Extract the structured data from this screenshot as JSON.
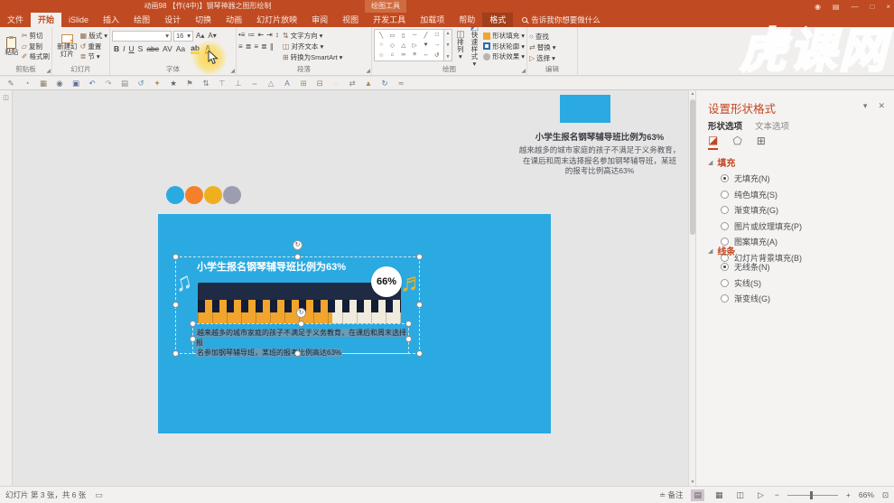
{
  "accent": "#c2471e",
  "watermark": "虎课网",
  "window": {
    "title": "动画98 【作(4中)】钢琴神器之图形绘制",
    "context_tab_header": "绘图工具",
    "controls": [
      {
        "name": "account-icon",
        "glyph": "◉"
      },
      {
        "name": "ribbon-display-options-icon",
        "glyph": "▤"
      },
      {
        "name": "minimize-icon",
        "glyph": "—"
      },
      {
        "name": "restore-icon",
        "glyph": "□"
      },
      {
        "name": "close-icon",
        "glyph": "×"
      }
    ]
  },
  "tabs": [
    {
      "label": "文件"
    },
    {
      "label": "开始",
      "state": "selected"
    },
    {
      "label": "iSlide"
    },
    {
      "label": "插入"
    },
    {
      "label": "绘图"
    },
    {
      "label": "设计"
    },
    {
      "label": "切换"
    },
    {
      "label": "动画"
    },
    {
      "label": "幻灯片放映"
    },
    {
      "label": "审阅"
    },
    {
      "label": "视图"
    },
    {
      "label": "开发工具"
    },
    {
      "label": "加载项"
    },
    {
      "label": "帮助"
    },
    {
      "label": "格式",
      "state": "context"
    }
  ],
  "search": {
    "placeholder": "告诉我你想要做什么"
  },
  "ribbon": {
    "clipboard": {
      "label": "剪贴板",
      "paste": "粘贴",
      "cut": "剪切",
      "copy": "复制",
      "painter": "格式刷"
    },
    "slides": {
      "label": "幻灯片",
      "new_slide": "新建幻灯片",
      "layout": "版式",
      "reset": "重置",
      "section": "节"
    },
    "font": {
      "label": "字体",
      "size": "16",
      "style_buttons": [
        {
          "name": "bold-button",
          "glyph": "B",
          "cls": "b"
        },
        {
          "name": "italic-button",
          "glyph": "I",
          "cls": "i"
        },
        {
          "name": "underline-button",
          "glyph": "U",
          "cls": "u"
        },
        {
          "name": "shadow-button",
          "glyph": "S"
        },
        {
          "name": "strikethrough-button",
          "glyph": "abc",
          "cls": "s"
        },
        {
          "name": "character-spacing-button",
          "glyph": "AV"
        },
        {
          "name": "change-case-button",
          "glyph": "Aa"
        }
      ]
    },
    "paragraph": {
      "label": "段落",
      "row1_icons": [
        {
          "name": "bullets-icon",
          "glyph": "•≡"
        },
        {
          "name": "numbering-icon",
          "glyph": "≔"
        },
        {
          "name": "decrease-indent-icon",
          "glyph": "⇤"
        },
        {
          "name": "increase-indent-icon",
          "glyph": "⇥"
        },
        {
          "name": "line-spacing-icon",
          "glyph": "↕"
        }
      ],
      "row2_icons": [
        {
          "name": "align-left-icon",
          "glyph": "≡"
        },
        {
          "name": "align-center-icon",
          "glyph": "≣"
        },
        {
          "name": "align-right-icon",
          "glyph": "≡"
        },
        {
          "name": "justify-icon",
          "glyph": "≣"
        },
        {
          "name": "columns-icon",
          "glyph": "∥"
        }
      ],
      "text_direction": "文字方向",
      "align_text": "对齐文本",
      "smartart": "转换为SmartArt"
    },
    "drawing": {
      "label": "绘图",
      "arrange": "排列",
      "quick_styles": "快速样式",
      "shape_fill": "形状填充",
      "shape_outline": "形状轮廓",
      "shape_effects": "形状效果",
      "shapes": [
        {
          "name": "shape-line",
          "glyph": "╲"
        },
        {
          "name": "shape-rect",
          "glyph": "▭"
        },
        {
          "name": "shape-rounded",
          "glyph": "▯"
        },
        {
          "name": "shape-hline",
          "glyph": "─"
        },
        {
          "name": "shape-diag",
          "glyph": "╱"
        },
        {
          "name": "shape-square",
          "glyph": "□"
        },
        {
          "name": "shape-circle",
          "glyph": "○"
        },
        {
          "name": "shape-diamond",
          "glyph": "◇"
        },
        {
          "name": "shape-triangle",
          "glyph": "△"
        },
        {
          "name": "shape-arrowhead",
          "glyph": "▷"
        },
        {
          "name": "shape-heart",
          "glyph": "♥"
        },
        {
          "name": "shape-arrow",
          "glyph": "→"
        },
        {
          "name": "shape-star",
          "glyph": "☆"
        },
        {
          "name": "shape-house",
          "glyph": "⌂"
        },
        {
          "name": "shape-wave",
          "glyph": "∞"
        },
        {
          "name": "shape-equal",
          "glyph": "≡"
        },
        {
          "name": "shape-updown",
          "glyph": "↔"
        },
        {
          "name": "shape-loop",
          "glyph": "↺"
        }
      ]
    },
    "editing": {
      "label": "编辑",
      "find": "查找",
      "replace": "替换",
      "select": "选择"
    }
  },
  "qat": {
    "icons": [
      {
        "name": "qat-brush-icon",
        "glyph": "✎",
        "color": "#6b7c95"
      },
      {
        "name": "qat-timer-icon",
        "glyph": "◔",
        "color": "#7a8a6d"
      },
      {
        "name": "qat-layout-icon",
        "glyph": "▦",
        "color": "#8a7d6d"
      },
      {
        "name": "qat-camera-icon",
        "glyph": "◉",
        "color": "#6d7d8a"
      },
      {
        "name": "qat-save-icon",
        "glyph": "▣",
        "color": "#5f6f9a"
      },
      {
        "name": "qat-undo-icon",
        "glyph": "↶",
        "color": "#4f79b0"
      },
      {
        "name": "qat-redo-icon",
        "glyph": "↷",
        "color": "#9aa0a6"
      },
      {
        "name": "qat-email-icon",
        "glyph": "▤",
        "color": "#8a8683"
      },
      {
        "name": "qat-refresh-icon",
        "glyph": "↺",
        "color": "#5f8fb0"
      },
      {
        "name": "qat-star-add-icon",
        "glyph": "✦",
        "color": "#b08f4f"
      },
      {
        "name": "qat-star-icon",
        "glyph": "★",
        "color": "#54626e"
      },
      {
        "name": "qat-flag-icon",
        "glyph": "⚑",
        "color": "#8a8683"
      },
      {
        "name": "qat-sort-icon",
        "glyph": "⇅",
        "color": "#6d7d8a"
      },
      {
        "name": "qat-align-top-icon",
        "glyph": "⊤",
        "color": "#8a8683"
      },
      {
        "name": "qat-align-bottom-icon",
        "glyph": "⊥",
        "color": "#8a8683"
      },
      {
        "name": "qat-distribute-icon",
        "glyph": "⇔",
        "color": "#6d8a7d"
      },
      {
        "name": "qat-shape-icon",
        "glyph": "△",
        "color": "#8a8683"
      },
      {
        "name": "qat-text-icon",
        "glyph": "A",
        "color": "#6b7c95"
      },
      {
        "name": "qat-group-icon",
        "glyph": "⊞",
        "color": "#7aa06a"
      },
      {
        "name": "qat-ungroup-icon",
        "glyph": "⊟",
        "color": "#a0806a"
      },
      {
        "name": "qat-ring-icon",
        "glyph": "◌",
        "color": "#b8b4b0"
      },
      {
        "name": "qat-swap-icon",
        "glyph": "⇄",
        "color": "#8a8683"
      },
      {
        "name": "qat-color-icon",
        "glyph": "▲",
        "color": "#b0894f"
      },
      {
        "name": "qat-reset-icon",
        "glyph": "↻",
        "color": "#5f79a0"
      },
      {
        "name": "qat-more-icon",
        "glyph": "≂",
        "color": "#8a8683"
      }
    ]
  },
  "canvas": {
    "top_shape_color": "#2baae2",
    "heading": "小学生报名钢琴辅导班比例为63%",
    "body_lines": [
      "越来越多的城市家庭的孩子不满足于义务教育，",
      "在课后和周末选择报名参加钢琴辅导班，某班",
      "的报考比例高达63%"
    ],
    "dots": [
      {
        "name": "dot-blue",
        "bg": "#2baae2"
      },
      {
        "name": "dot-orange",
        "bg": "#f4802b"
      },
      {
        "name": "dot-amber",
        "bg": "#eeb01f"
      },
      {
        "name": "dot-gray",
        "bg": "#9d9db1"
      }
    ],
    "slide": {
      "bg": "#2baae2",
      "title": "小学生报名钢琴辅导班比例为63%",
      "badge": "66%",
      "fill_percent": 66,
      "colors": {
        "lid": "#1f2a44",
        "filled_keys": "#f2a52c",
        "empty_keys": "#f0ebdc"
      },
      "text_lines": [
        "越来越多的城市家庭的孩子不满足于义务教育，在课后和周末选择报",
        "名参加钢琴辅导班，某班的报考比例高达63%"
      ]
    }
  },
  "pane": {
    "title": "设置形状格式",
    "tabs": [
      {
        "label": "形状选项",
        "selected": true,
        "name": "pane-tab-shape-options"
      },
      {
        "label": "文本选项",
        "name": "pane-tab-text-options"
      }
    ],
    "fill_section": "填充",
    "fill_options": [
      {
        "label": "无填充(N)",
        "selected": true
      },
      {
        "label": "纯色填充(S)"
      },
      {
        "label": "渐变填充(G)"
      },
      {
        "label": "图片或纹理填充(P)"
      },
      {
        "label": "图案填充(A)"
      },
      {
        "label": "幻灯片背景填充(B)"
      }
    ],
    "line_section": "线条",
    "line_options": [
      {
        "label": "无线条(N)",
        "selected": true
      },
      {
        "label": "实线(S)"
      },
      {
        "label": "渐变线(G)"
      }
    ]
  },
  "status": {
    "slide_info": "幻灯片 第 3 张，共 6 张",
    "notes": "备注",
    "zoom": "66%"
  }
}
